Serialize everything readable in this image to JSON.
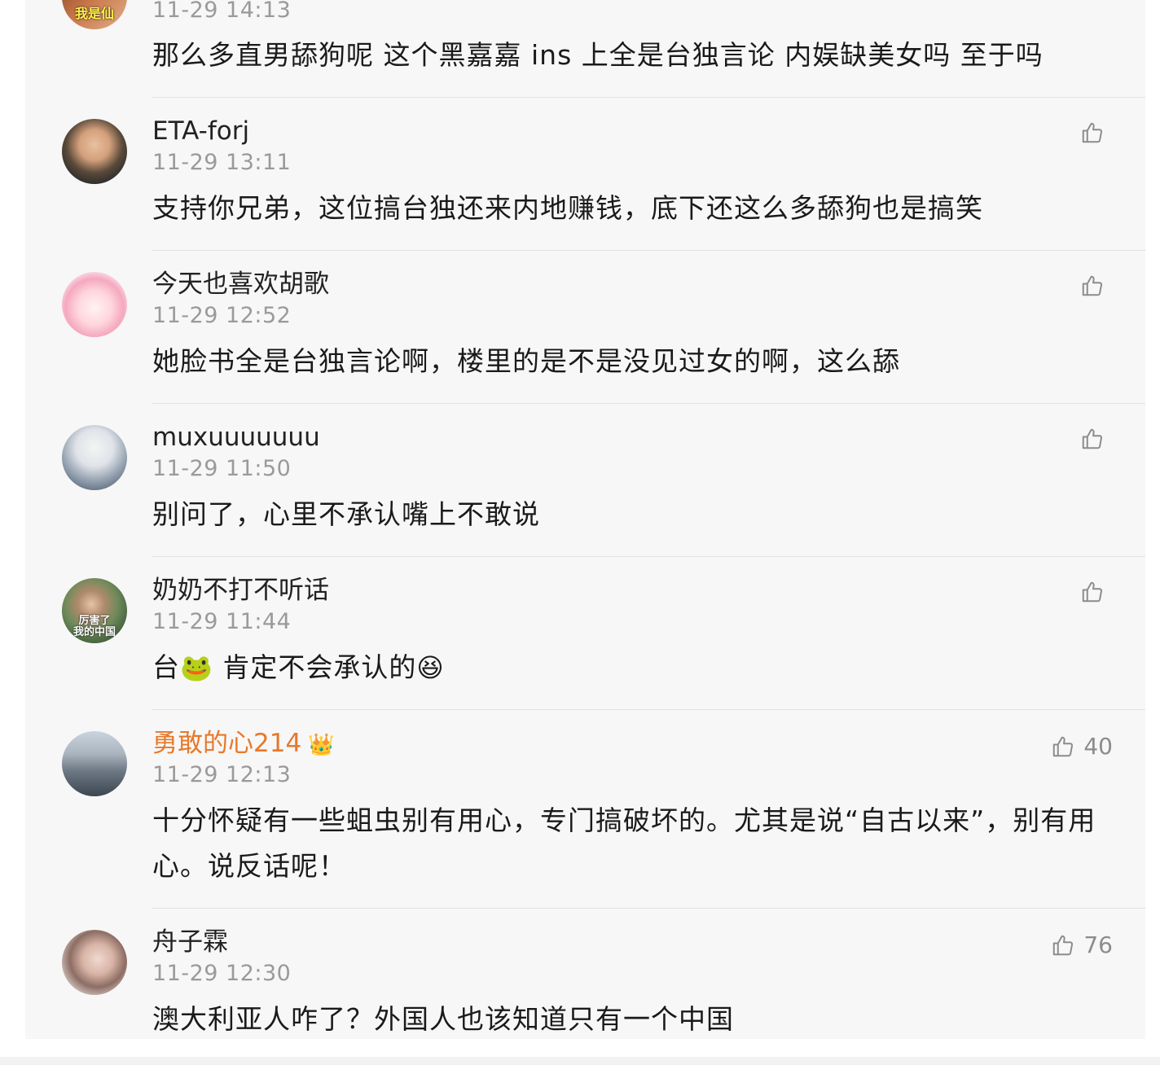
{
  "comments": [
    {
      "avatar_caption": "我是仙",
      "user": "",
      "time": "11-29 14:13",
      "text": "那么多直男舔狗呢 这个黑嘉嘉 ins 上全是台独言论  内娱缺美女吗 至于吗",
      "likes": ""
    },
    {
      "user": "ETA-forj",
      "time": "11-29 13:11",
      "text": "支持你兄弟，这位搞台独还来内地赚钱，底下还这么多舔狗也是搞笑",
      "likes": ""
    },
    {
      "user": "今天也喜欢胡歌",
      "time": "11-29 12:52",
      "text": "她脸书全是台独言论啊，楼里的是不是没见过女的啊，这么舔",
      "likes": ""
    },
    {
      "user": "muxuuuuuuu",
      "time": "11-29 11:50",
      "text": "别问了，心里不承认嘴上不敢说",
      "likes": ""
    },
    {
      "avatar_caption": "厉害了 我的中国",
      "user": "奶奶不打不听话",
      "time": "11-29 11:44",
      "text_before": "台",
      "emoji_1": "🐸",
      "text_after": " 肯定不会承认的",
      "emoji_2": "😆",
      "likes": ""
    },
    {
      "user": "勇敢的心214",
      "user_badge": "👑",
      "time": "11-29 12:13",
      "text": "十分怀疑有一些蛆虫别有用心，专门搞破坏的。尤其是说“自古以来”，别有用心。说反话呢！",
      "likes": "40"
    },
    {
      "user": "舟子霖",
      "time": "11-29 12:30",
      "text": "澳大利亚人咋了？外国人也该知道只有一个中国",
      "likes": "76"
    }
  ],
  "colors": {
    "feed_background": "#f7f7f7",
    "vip_username": "#e8782a",
    "timestamp": "#9a9a9a",
    "like_icon": "#8c8c8c"
  },
  "icons": {
    "like": "thumbs-up-icon",
    "vip": "crown-icon"
  }
}
